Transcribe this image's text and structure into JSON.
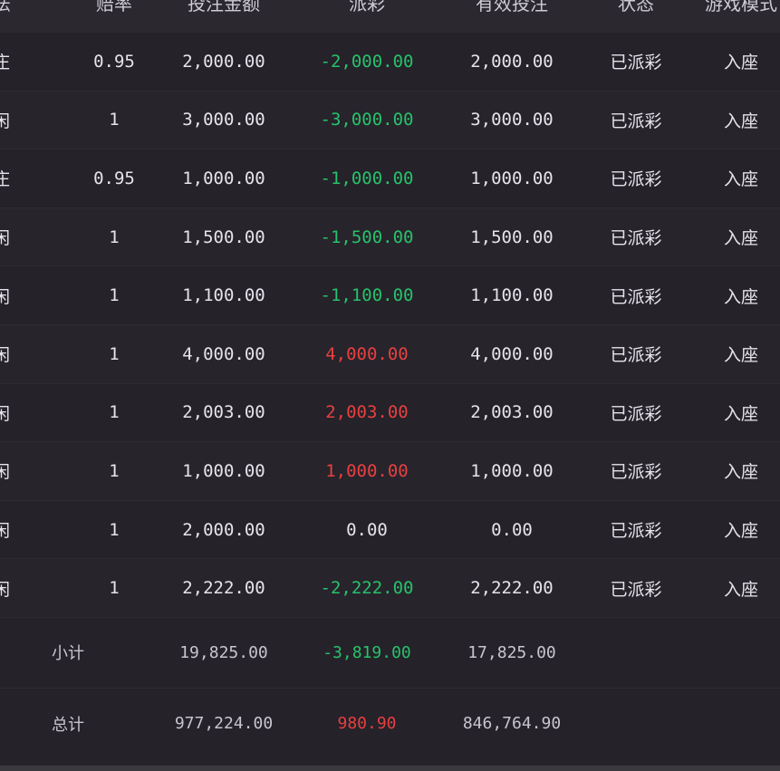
{
  "headers": {
    "play": "法",
    "odds": "赔率",
    "amount": "投注金额",
    "payout": "派彩",
    "valid": "有效投注",
    "status": "状态",
    "mode": "游戏模式"
  },
  "rows": [
    {
      "play": "庄",
      "odds": "0.95",
      "amount": "2,000.00",
      "payout": "-2,000.00",
      "payout_sign": "neg",
      "valid": "2,000.00",
      "status": "已派彩",
      "mode": "入座"
    },
    {
      "play": "闲",
      "odds": "1",
      "amount": "3,000.00",
      "payout": "-3,000.00",
      "payout_sign": "neg",
      "valid": "3,000.00",
      "status": "已派彩",
      "mode": "入座"
    },
    {
      "play": "庄",
      "odds": "0.95",
      "amount": "1,000.00",
      "payout": "-1,000.00",
      "payout_sign": "neg",
      "valid": "1,000.00",
      "status": "已派彩",
      "mode": "入座"
    },
    {
      "play": "闲",
      "odds": "1",
      "amount": "1,500.00",
      "payout": "-1,500.00",
      "payout_sign": "neg",
      "valid": "1,500.00",
      "status": "已派彩",
      "mode": "入座"
    },
    {
      "play": "闲",
      "odds": "1",
      "amount": "1,100.00",
      "payout": "-1,100.00",
      "payout_sign": "neg",
      "valid": "1,100.00",
      "status": "已派彩",
      "mode": "入座"
    },
    {
      "play": "闲",
      "odds": "1",
      "amount": "4,000.00",
      "payout": "4,000.00",
      "payout_sign": "pos",
      "valid": "4,000.00",
      "status": "已派彩",
      "mode": "入座"
    },
    {
      "play": "闲",
      "odds": "1",
      "amount": "2,003.00",
      "payout": "2,003.00",
      "payout_sign": "pos",
      "valid": "2,003.00",
      "status": "已派彩",
      "mode": "入座"
    },
    {
      "play": "闲",
      "odds": "1",
      "amount": "1,000.00",
      "payout": "1,000.00",
      "payout_sign": "pos",
      "valid": "1,000.00",
      "status": "已派彩",
      "mode": "入座"
    },
    {
      "play": "闲",
      "odds": "1",
      "amount": "2,000.00",
      "payout": "0.00",
      "payout_sign": "zero",
      "valid": "0.00",
      "status": "已派彩",
      "mode": "入座"
    },
    {
      "play": "闲",
      "odds": "1",
      "amount": "2,222.00",
      "payout": "-2,222.00",
      "payout_sign": "neg",
      "valid": "2,222.00",
      "status": "已派彩",
      "mode": "入座"
    }
  ],
  "subtotal": {
    "label": "小计",
    "amount": "19,825.00",
    "payout": "-3,819.00",
    "valid": "17,825.00"
  },
  "total": {
    "label": "总计",
    "amount": "977,224.00",
    "payout": "980.90",
    "valid": "846,764.90"
  },
  "colors": {
    "negative": "#27c26a",
    "positive": "#e8403f",
    "background": "#25222a"
  }
}
